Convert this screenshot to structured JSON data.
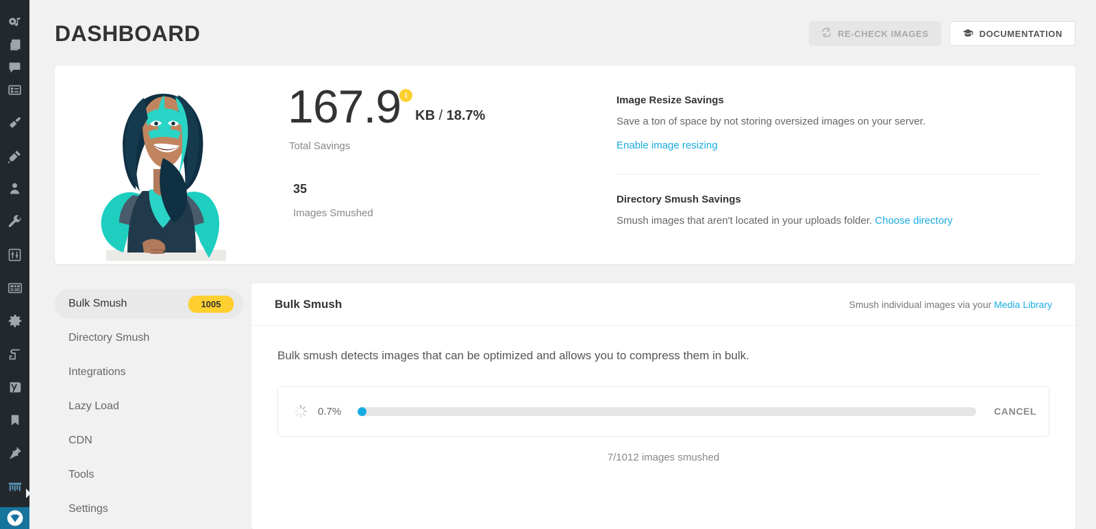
{
  "wp_sidebar": {
    "items": [
      {
        "name": "media-icon",
        "label": "Media"
      },
      {
        "name": "pages-icon",
        "label": "Pages"
      },
      {
        "name": "comments-icon",
        "label": "Comments"
      },
      {
        "name": "forms-icon",
        "label": "Forms"
      },
      {
        "name": "appearance-brush-icon",
        "label": "Appearance"
      },
      {
        "name": "plugins-plug-icon",
        "label": "Plugins"
      },
      {
        "name": "users-icon",
        "label": "Users"
      },
      {
        "name": "tools-wrench-icon",
        "label": "Tools"
      },
      {
        "name": "settings-sliders-icon",
        "label": "Settings"
      },
      {
        "name": "table-grid-icon",
        "label": "Table"
      },
      {
        "name": "gear-icon",
        "label": "Options"
      },
      {
        "name": "akismet-a-icon",
        "label": "Akismet"
      },
      {
        "name": "yoast-y-icon",
        "label": "Yoast SEO"
      },
      {
        "name": "bookmark-icon",
        "label": "Bookmark"
      },
      {
        "name": "pin-icon",
        "label": "Pinned"
      },
      {
        "name": "hustle-icon",
        "label": "Hustle"
      },
      {
        "name": "smush-shield-icon",
        "label": "Smush",
        "active": true
      }
    ]
  },
  "header": {
    "title": "DASHBOARD",
    "recheck_label": "RE-CHECK IMAGES",
    "recheck_icon": "refresh-icon",
    "documentation_label": "DOCUMENTATION",
    "documentation_icon": "graduation-cap-icon"
  },
  "summary": {
    "mascot_alt": "smush-hero-illustration",
    "total_savings_value": "167.9",
    "info_badge": "i",
    "unit": "KB",
    "separator": "/",
    "percent": "18.7%",
    "total_savings_label": "Total Savings",
    "images_smushed_count": "35",
    "images_smushed_label": "Images Smushed",
    "resize": {
      "title": "Image Resize Savings",
      "description": "Save a ton of space by not storing oversized images on your server.",
      "link": "Enable image resizing"
    },
    "directory": {
      "title": "Directory Smush Savings",
      "description": "Smush images that aren't located in your uploads folder.",
      "link": "Choose directory"
    }
  },
  "side_nav": {
    "items": [
      {
        "label": "Bulk Smush",
        "badge": "1005",
        "active": true
      },
      {
        "label": "Directory Smush",
        "badge": "",
        "active": false
      },
      {
        "label": "Integrations",
        "badge": "",
        "active": false
      },
      {
        "label": "Lazy Load",
        "badge": "",
        "active": false
      },
      {
        "label": "CDN",
        "badge": "",
        "active": false
      },
      {
        "label": "Tools",
        "badge": "",
        "active": false
      },
      {
        "label": "Settings",
        "badge": "",
        "active": false
      }
    ]
  },
  "content": {
    "title": "Bulk Smush",
    "subtitle_prefix": "Smush individual images via your ",
    "subtitle_link": "Media Library",
    "description": "Bulk smush detects images that can be optimized and allows you to compress them in bulk.",
    "progress": {
      "percent_label": "0.7%",
      "percent_value": 0.7,
      "cancel_label": "CANCEL",
      "status": "7/1012 images smushed",
      "spinner_icon": "loading-spinner-icon"
    }
  },
  "colors": {
    "accent_blue": "#19ace2",
    "badge_yellow": "#fecf2f",
    "sidebar_dark": "#23282d",
    "brand_active": "#17749d",
    "page_bg": "#f1f1f1"
  }
}
